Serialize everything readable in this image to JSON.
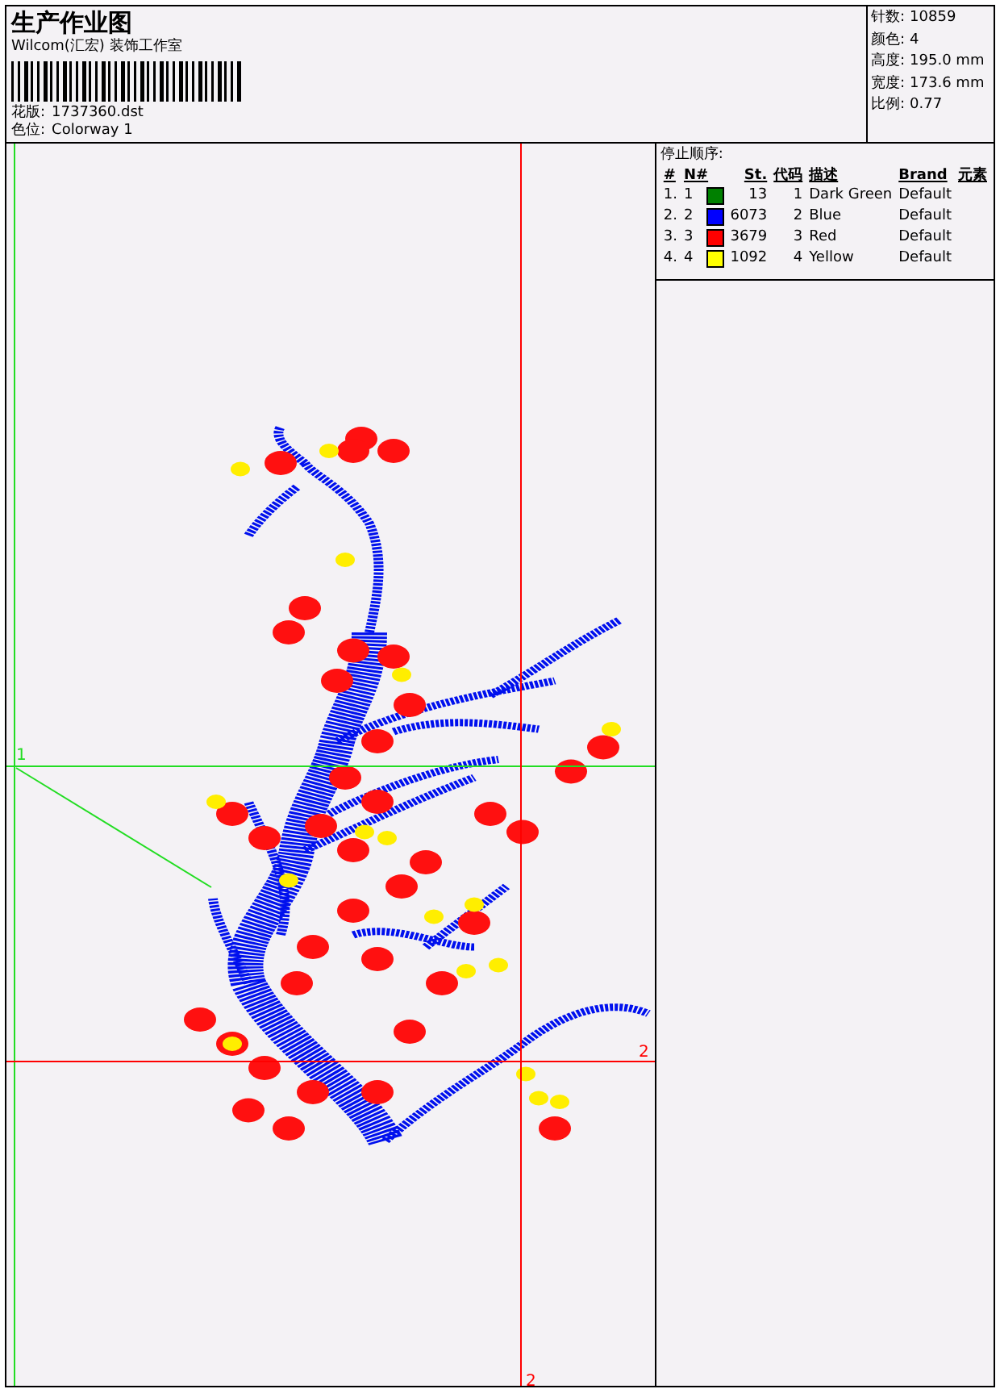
{
  "header": {
    "title": "生产作业图",
    "studio": "Wilcom(汇宏) 装饰工作室",
    "fields": [
      {
        "label": "花版:",
        "value": "1737360.dst"
      },
      {
        "label": "色位:",
        "value": "Colorway 1"
      }
    ]
  },
  "stats": [
    {
      "label": "针数:",
      "value": "10859"
    },
    {
      "label": "颜色:",
      "value": "4"
    },
    {
      "label": "高度:",
      "value": "195.0 mm"
    },
    {
      "label": "宽度:",
      "value": "173.6 mm"
    },
    {
      "label": "比例:",
      "value": "0.77"
    }
  ],
  "stop_sequence": {
    "title": "停止顺序:",
    "columns": [
      "#",
      "N#",
      "St.",
      "代码",
      "描述",
      "Brand",
      "元素"
    ],
    "rows": [
      {
        "index": "1.",
        "n": "1",
        "color": "#008000",
        "stitches": "13",
        "code": "1",
        "description": "Dark Green",
        "brand": "Default"
      },
      {
        "index": "2.",
        "n": "2",
        "color": "#0000ff",
        "stitches": "6073",
        "code": "2",
        "description": "Blue",
        "brand": "Default"
      },
      {
        "index": "3.",
        "n": "3",
        "color": "#ff0000",
        "stitches": "3679",
        "code": "3",
        "description": "Red",
        "brand": "Default"
      },
      {
        "index": "4.",
        "n": "4",
        "color": "#ffff00",
        "stitches": "1092",
        "code": "4",
        "description": "Yellow",
        "brand": "Default"
      }
    ]
  },
  "guides": [
    {
      "color": "#22dd22",
      "labels": [
        "1"
      ]
    },
    {
      "color": "#ff0000",
      "labels": [
        "2",
        "2"
      ]
    }
  ]
}
